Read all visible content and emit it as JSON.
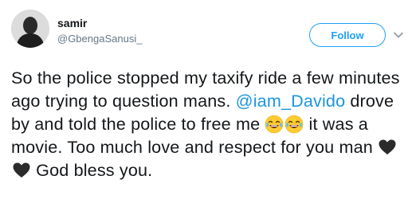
{
  "author": {
    "name": "samir",
    "handle": "@GbengaSanusi_"
  },
  "follow_button": {
    "label": "Follow"
  },
  "tweet": {
    "part1": "So the police stopped my taxify ride a few minutes ago trying to question mans. ",
    "mention": "@iam_Davido",
    "part2": " drove by and told the police to free me ",
    "part3": " it was a movie. Too much love and respect for you man ",
    "part4": " God bless you."
  },
  "icons": {
    "avatar": "avatar",
    "caret": "chevron-down-icon",
    "laugh_emoji": "face-with-tears-of-joy-emoji",
    "heart_emoji": "black-heart-emoji"
  },
  "colors": {
    "accent": "#1da1f2",
    "mention": "#1b95e0",
    "text": "#14171a",
    "muted": "#657786"
  }
}
